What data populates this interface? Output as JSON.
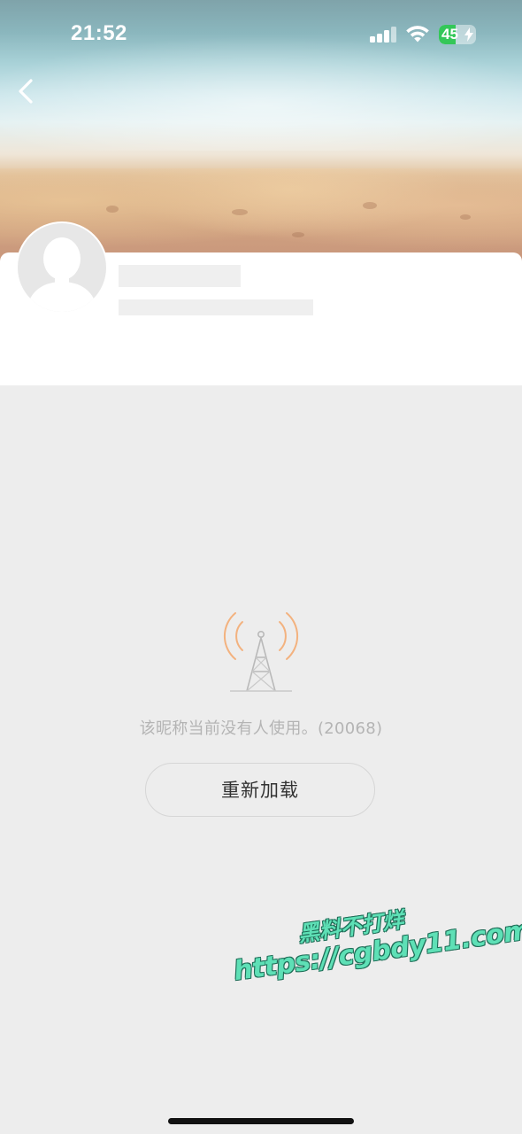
{
  "status_bar": {
    "time": "21:52",
    "battery_percent": "45",
    "battery_level": 0.45,
    "charging": true,
    "signal_icon": "cellular-signal-icon",
    "wifi_icon": "wifi-icon"
  },
  "nav": {
    "back_icon": "chevron-left-icon"
  },
  "profile": {
    "avatar_icon": "default-avatar-icon",
    "name_placeholder": "",
    "subtitle_placeholder": ""
  },
  "error": {
    "icon": "signal-tower-icon",
    "message": "该昵称当前没有人使用。(20068)",
    "reload_label": "重新加载"
  },
  "watermark": {
    "line1": "黑料不打烊",
    "line2": "https://cgbdy11.com"
  },
  "colors": {
    "background": "#ededed",
    "card": "#ffffff",
    "skeleton": "#efefef",
    "error_text": "#b4b4b4",
    "tower_waves": "#f3b27f",
    "battery_green": "#34c759",
    "watermark": "#5ee0b6"
  }
}
